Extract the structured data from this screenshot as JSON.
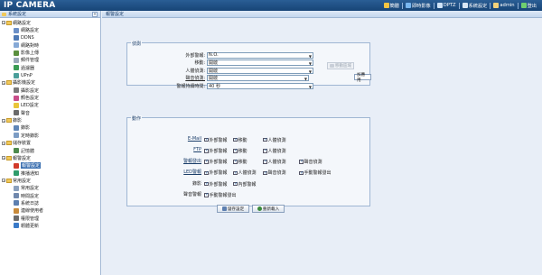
{
  "app": {
    "brand": "IP CAMERA"
  },
  "topnav": [
    {
      "label": "簡體",
      "icon": "chinese-simplified-icon",
      "color": "#f5c542"
    },
    {
      "label": "即時影像",
      "icon": "live-video-icon",
      "color": "#78b6ef"
    },
    {
      "label": "DPTZ",
      "icon": "dptz-icon",
      "color": "#cfe3f7"
    },
    {
      "label": "系統設定",
      "icon": "system-settings-icon",
      "color": "#d8e6f4"
    },
    {
      "label": "admin",
      "icon": "user-icon",
      "color": "#f2d27a"
    },
    {
      "label": "登出",
      "icon": "logout-icon",
      "color": "#6fcf6f"
    }
  ],
  "sidebar": {
    "title": "系統設定",
    "collapse_glyph": "«",
    "items": [
      {
        "label": "網路設定",
        "type": "group",
        "expanded": true
      },
      {
        "label": "網路設定",
        "type": "leaf",
        "icon": "network-icon",
        "color": "#6b8fc7"
      },
      {
        "label": "DDNS",
        "type": "leaf",
        "icon": "ddns-icon",
        "color": "#4f79b5"
      },
      {
        "label": "網路對時",
        "type": "leaf",
        "icon": "time-sync-icon",
        "color": "#86a9d6"
      },
      {
        "label": "影像上傳",
        "type": "leaf",
        "icon": "upload-icon",
        "color": "#5a8f3e"
      },
      {
        "label": "郵件管理",
        "type": "leaf",
        "icon": "mail-icon",
        "color": "#9aa8b8"
      },
      {
        "label": "過濾器",
        "type": "leaf",
        "icon": "filter-icon",
        "color": "#3b9c54"
      },
      {
        "label": "UPnP",
        "type": "leaf",
        "icon": "upnp-icon",
        "color": "#4a9e9a"
      },
      {
        "label": "攝影機設定",
        "type": "group",
        "expanded": true
      },
      {
        "label": "攝影設定",
        "type": "leaf",
        "icon": "camera-settings-icon",
        "color": "#7a7a7a"
      },
      {
        "label": "顏色設定",
        "type": "leaf",
        "icon": "color-icon",
        "color": "#c94d8a"
      },
      {
        "label": "LED設定",
        "type": "leaf",
        "icon": "led-icon",
        "color": "#e9c53a"
      },
      {
        "label": "聲音",
        "type": "leaf",
        "icon": "sound-icon",
        "color": "#6a6a6a"
      },
      {
        "label": "錄影",
        "type": "group",
        "expanded": true
      },
      {
        "label": "錄影",
        "type": "leaf",
        "icon": "record-icon",
        "color": "#5f86b8"
      },
      {
        "label": "定時錄影",
        "type": "leaf",
        "icon": "schedule-record-icon",
        "color": "#7c9cc4"
      },
      {
        "label": "儲存裝置",
        "type": "group",
        "expanded": true
      },
      {
        "label": "記憶體",
        "type": "leaf",
        "icon": "memory-icon",
        "color": "#4d8a4d"
      },
      {
        "label": "報警設定",
        "type": "group",
        "expanded": true
      },
      {
        "label": "報警設定",
        "type": "leaf",
        "icon": "alarm-icon",
        "color": "#d23a2a",
        "selected": true
      },
      {
        "label": "推播通知",
        "type": "leaf",
        "icon": "push-notify-icon",
        "color": "#2f9c6a"
      },
      {
        "label": "常用設定",
        "type": "group",
        "expanded": true
      },
      {
        "label": "常用設定",
        "type": "leaf",
        "icon": "common-settings-icon",
        "color": "#8aa0bd"
      },
      {
        "label": "時間設定",
        "type": "leaf",
        "icon": "clock-icon",
        "color": "#7088ad"
      },
      {
        "label": "系統日誌",
        "type": "leaf",
        "icon": "log-icon",
        "color": "#5d7fb0"
      },
      {
        "label": "連線使用者",
        "type": "leaf",
        "icon": "users-icon",
        "color": "#c88a3a"
      },
      {
        "label": "權限管理",
        "type": "leaf",
        "icon": "permission-icon",
        "color": "#6b6b6b"
      },
      {
        "label": "韌體更新",
        "type": "leaf",
        "icon": "firmware-icon",
        "color": "#3a7ac8"
      }
    ]
  },
  "main": {
    "title": "報警設定",
    "detect": {
      "legend": "偵測",
      "fields": [
        {
          "label": "外部警報:",
          "value": "N.O.",
          "underline": false
        },
        {
          "label": "移動:",
          "value": "開啟",
          "underline": false
        },
        {
          "label": "人體偵測:",
          "value": "開啟",
          "underline": false
        },
        {
          "label": "聲音偵測:",
          "value": "開啟",
          "underline": true
        },
        {
          "label": "警報持續時間:",
          "value": "40 秒",
          "underline": false
        }
      ],
      "motion_area_button": "移動區域",
      "apply_button": "加應用"
    },
    "action": {
      "legend": "動作",
      "rows": [
        {
          "label": "E-Mail",
          "link": true,
          "options": [
            {
              "label": "外部警報",
              "checked": true,
              "col": 0
            },
            {
              "label": "移動",
              "checked": true,
              "col": 1
            },
            {
              "label": "人體偵測",
              "checked": true,
              "col": 2
            }
          ]
        },
        {
          "label": "FTP",
          "link": true,
          "options": [
            {
              "label": "外部警報",
              "checked": true,
              "col": 0
            },
            {
              "label": "移動",
              "checked": true,
              "col": 1
            },
            {
              "label": "人體偵測",
              "checked": true,
              "col": 2
            }
          ]
        },
        {
          "label": "警報發出",
          "link": true,
          "options": [
            {
              "label": "外部警報",
              "checked": true,
              "col": 0
            },
            {
              "label": "移動",
              "checked": true,
              "col": 1
            },
            {
              "label": "人體偵測",
              "checked": true,
              "col": 2
            },
            {
              "label": "聲音偵測",
              "checked": true,
              "col": 3
            }
          ]
        },
        {
          "label": "LED警報",
          "link": true,
          "options": [
            {
              "label": "外部警報",
              "checked": true,
              "col": 0
            },
            {
              "label": "人體偵測",
              "checked": true,
              "col": 1
            },
            {
              "label": "聲音偵測",
              "checked": true,
              "col": 2
            },
            {
              "label": "手動警報發出",
              "checked": true,
              "col": 3
            }
          ]
        },
        {
          "label": "錄影",
          "link": false,
          "options": [
            {
              "label": "外部警報",
              "checked": true,
              "col": 0
            },
            {
              "label": "內部警報",
              "checked": true,
              "col": 1
            }
          ]
        },
        {
          "label": "聲音警報",
          "link": false,
          "options": [
            {
              "label": "手動警報發出",
              "checked": true,
              "col": 0
            }
          ]
        }
      ]
    },
    "buttons": {
      "save": "儲存設定",
      "reload": "重新載入"
    }
  }
}
